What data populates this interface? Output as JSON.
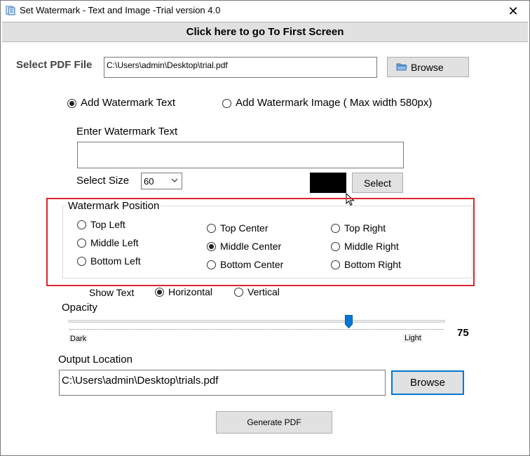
{
  "window": {
    "title": "Set Watermark  - Text and Image -Trial version 4.0",
    "close_glyph": "✕"
  },
  "nav": {
    "first_screen_label": "Click here to go To First Screen"
  },
  "pdf_file": {
    "label": "Select PDF File",
    "path": "C:\\Users\\admin\\Desktop\\trial.pdf",
    "browse_label": "Browse"
  },
  "mode": {
    "text_label": "Add Watermark Text",
    "image_label": "Add Watermark Image ( Max width 580px)",
    "selected": "text"
  },
  "watermark_text": {
    "label": "Enter Watermark Text",
    "value": ""
  },
  "size": {
    "label": "Select Size",
    "value": "60"
  },
  "color": {
    "swatch": "#000000",
    "select_label": "Select"
  },
  "position": {
    "legend": "Watermark Position",
    "options": [
      "Top Left",
      "Middle Left",
      "Bottom Left",
      "Top Center",
      "Middle Center",
      "Bottom Center",
      "Top Right",
      "Middle Right",
      "Bottom Right"
    ],
    "selected": "Middle Center"
  },
  "orientation": {
    "label": "Show Text",
    "horizontal": "Horizontal",
    "vertical": "Vertical",
    "selected": "Horizontal"
  },
  "opacity": {
    "label": "Opacity",
    "value": 75,
    "value_text": "75",
    "min_label": "Dark",
    "max_label": "Light"
  },
  "output": {
    "label": "Output Location",
    "path": "C:\\Users\\admin\\Desktop\\trials.pdf",
    "browse_label": "Browse"
  },
  "generate": {
    "label": "Generate PDF"
  },
  "colors": {
    "highlight": "#d9262e",
    "thumb": "#0078d7",
    "focus_border": "#0078d7"
  }
}
